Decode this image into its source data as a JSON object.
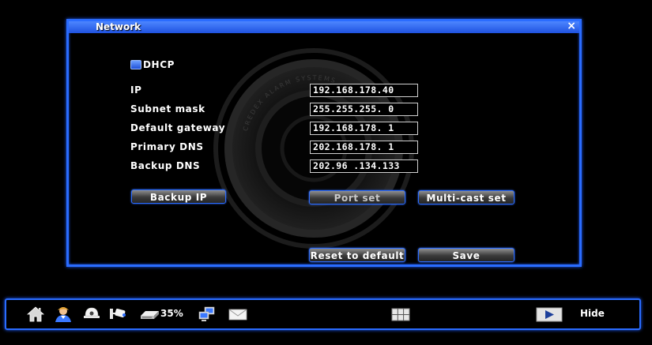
{
  "dialog": {
    "title": "Network",
    "close_symbol": "×"
  },
  "dhcp": {
    "label": "DHCP",
    "checked": true
  },
  "watermark": {
    "text": "CREDEX ALARM SYSTEMS"
  },
  "fields": [
    {
      "label": "IP",
      "value": "192.168.178.40"
    },
    {
      "label": "Subnet mask",
      "value": "255.255.255. 0"
    },
    {
      "label": "Default gateway",
      "value": "192.168.178. 1"
    },
    {
      "label": "Primary DNS",
      "value": "202.168.178. 1"
    },
    {
      "label": "Backup DNS",
      "value": "202.96 .134.133"
    }
  ],
  "buttons": {
    "backup_ip": "Backup IP",
    "port_set": "Port set",
    "multicast_set": "Multi-cast set",
    "reset_default": "Reset to default",
    "save": "Save"
  },
  "taskbar": {
    "icons": [
      "home-icon",
      "user-icon",
      "dome-camera-icon",
      "ptz-camera-icon",
      "hard-disk-icon",
      "network-icon",
      "message-icon",
      "split-screen-icon",
      "play-icon"
    ],
    "disk_percent": "35%",
    "hide_label": "Hide"
  },
  "colors": {
    "accent": "#2a6cff",
    "background": "#000000",
    "text": "#ffffff"
  }
}
